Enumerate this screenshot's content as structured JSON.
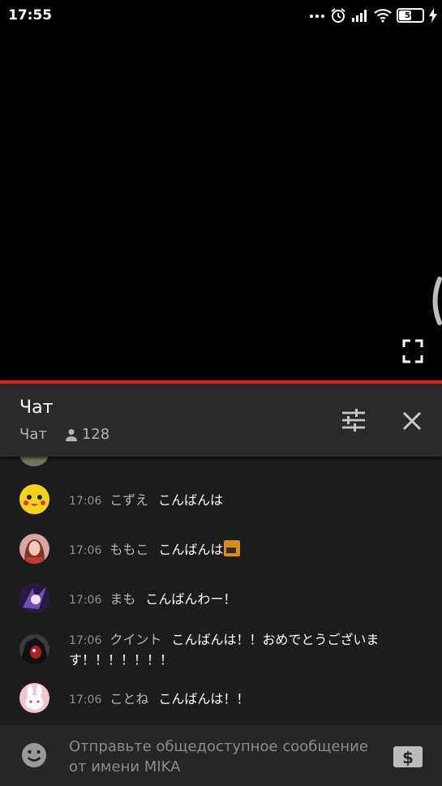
{
  "status_bar": {
    "time": "17:55",
    "battery": "50",
    "icons": [
      "more-dots-icon",
      "alarm-icon",
      "signal-icon",
      "wifi-icon",
      "battery-icon",
      "charging-icon"
    ]
  },
  "player": {
    "fullscreen_icon": "fullscreen-icon",
    "progress_color": "#e52117"
  },
  "chat_header": {
    "title": "Чат",
    "subtitle": "Чат",
    "viewer_count": "128",
    "filter_icon": "tune-icon",
    "close_icon": "close-icon"
  },
  "messages": [
    {
      "time": "17:06",
      "author": "こずえ",
      "text": "こんばんは",
      "emoji": false
    },
    {
      "time": "17:06",
      "author": "ももこ",
      "text": "こんばんは",
      "emoji": true
    },
    {
      "time": "17:06",
      "author": "まも",
      "text": "こんばんわー！",
      "emoji": false
    },
    {
      "time": "17:06",
      "author": "クイント",
      "text": "こんばんは！！おめでとうございます！！！！！！！",
      "emoji": false
    },
    {
      "time": "17:06",
      "author": "ことね",
      "text": "こんばんは！！",
      "emoji": false
    }
  ],
  "input": {
    "placeholder": "Отправьте общедоступное сообщение от имени MIKA",
    "emoji_icon": "emoji-icon",
    "superchat_icon": "dollar-icon"
  },
  "colors": {
    "accent": "#e52117",
    "header_bg": "#2a2a2a",
    "chat_bg": "#1c1c1c"
  }
}
